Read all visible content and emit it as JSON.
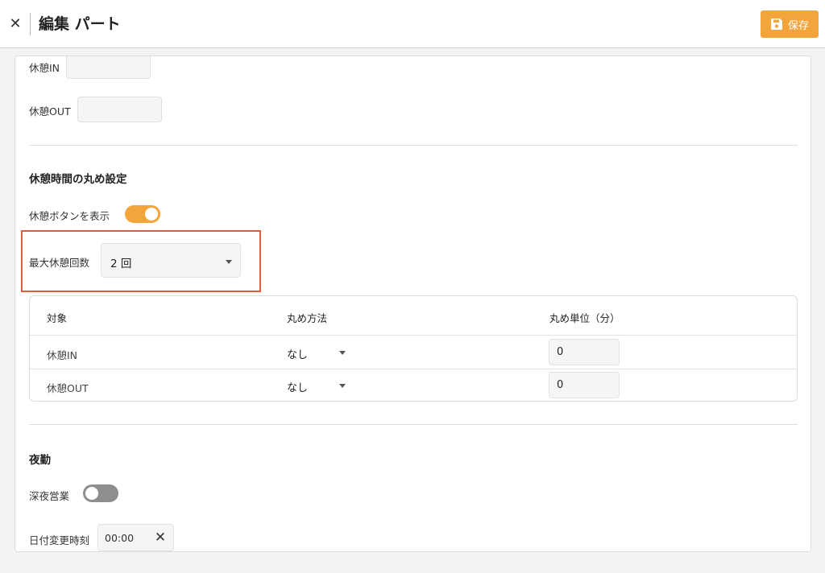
{
  "header": {
    "close_glyph": "✕",
    "title": "編集 パート",
    "save_label": "保存"
  },
  "break_fields": {
    "break_in_label": "休憩IN",
    "break_in_value": "",
    "break_out_label": "休憩OUT",
    "break_out_value": ""
  },
  "rounding": {
    "section_title": "休憩時間の丸め設定",
    "show_break_button_label": "休憩ボタンを表示",
    "show_break_button_on": true,
    "max_breaks_label": "最大休憩回数",
    "max_breaks_value": "2 回"
  },
  "table": {
    "headers": [
      "対象",
      "丸め方法",
      "丸め単位（分）"
    ],
    "rows": [
      {
        "target": "休憩IN",
        "method": "なし",
        "unit": "0"
      },
      {
        "target": "休憩OUT",
        "method": "なし",
        "unit": "0"
      }
    ]
  },
  "night": {
    "section_title": "夜勤",
    "late_night_label": "深夜営業",
    "late_night_on": false,
    "day_change_label": "日付変更時刻",
    "day_change_value": "00:00",
    "clear_glyph": "✕"
  },
  "colors": {
    "accent": "#f3a43b",
    "highlight_border": "#e25a3c",
    "toggle_off": "#8e8e8e"
  },
  "icons": {
    "close": "close-icon",
    "save": "floppy-disk-icon",
    "dropdown": "caret-down-icon",
    "clear": "clear-icon"
  }
}
